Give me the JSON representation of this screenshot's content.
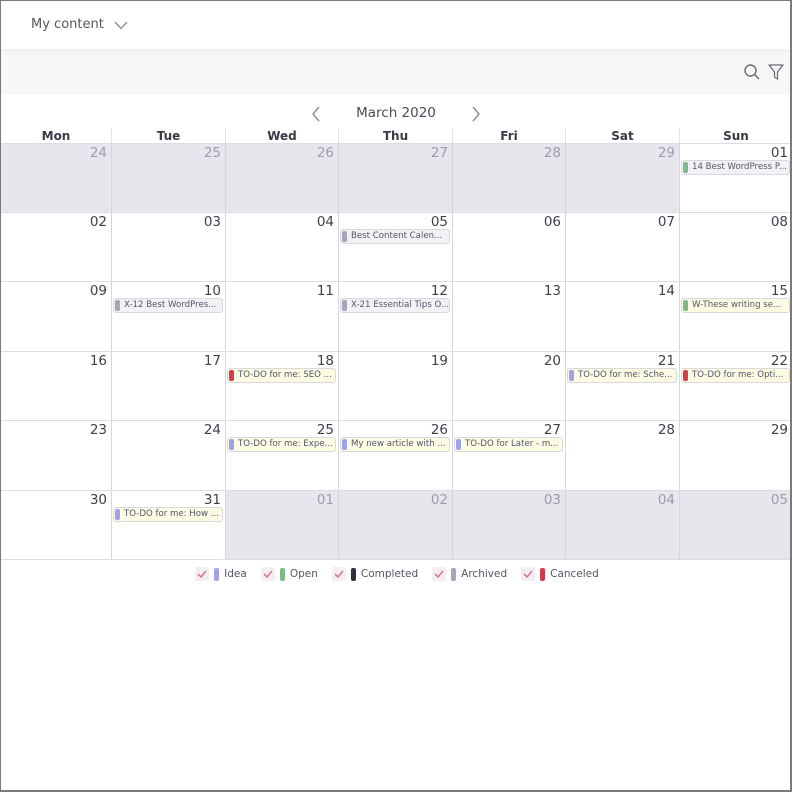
{
  "header": {
    "content_selector_label": "My content",
    "dropdown_icon": "chevron-down-icon"
  },
  "toolbar": {
    "search_icon": "search-icon",
    "filter_icon": "filter-icon"
  },
  "calendar": {
    "month_title": "March 2020",
    "prev_icon": "chevron-left-icon",
    "next_icon": "chevron-right-icon",
    "weekdays": [
      "Mon",
      "Tue",
      "Wed",
      "Thu",
      "Fri",
      "Sat",
      "Sun"
    ],
    "weeks": [
      [
        {
          "day": "24",
          "other": true
        },
        {
          "day": "25",
          "other": true
        },
        {
          "day": "26",
          "other": true
        },
        {
          "day": "27",
          "other": true
        },
        {
          "day": "28",
          "other": true
        },
        {
          "day": "29",
          "other": true
        },
        {
          "day": "01",
          "other": false,
          "event": {
            "title": "14 Best WordPress P...",
            "status": "Open",
            "highlight": false
          }
        }
      ],
      [
        {
          "day": "02",
          "other": false
        },
        {
          "day": "03",
          "other": false
        },
        {
          "day": "04",
          "other": false
        },
        {
          "day": "05",
          "other": false,
          "event": {
            "title": "Best Content Calen...",
            "status": "Archived",
            "highlight": false
          }
        },
        {
          "day": "06",
          "other": false
        },
        {
          "day": "07",
          "other": false
        },
        {
          "day": "08",
          "other": false
        }
      ],
      [
        {
          "day": "09",
          "other": false
        },
        {
          "day": "10",
          "other": false,
          "event": {
            "title": "X-12 Best WordPres...",
            "status": "Archived",
            "highlight": false
          }
        },
        {
          "day": "11",
          "other": false
        },
        {
          "day": "12",
          "other": false,
          "event": {
            "title": "X-21 Essential Tips O...",
            "status": "Archived",
            "highlight": false
          }
        },
        {
          "day": "13",
          "other": false
        },
        {
          "day": "14",
          "other": false
        },
        {
          "day": "15",
          "other": false,
          "event": {
            "title": "W-These writing se...",
            "status": "Open",
            "highlight": true
          }
        }
      ],
      [
        {
          "day": "16",
          "other": false
        },
        {
          "day": "17",
          "other": false
        },
        {
          "day": "18",
          "other": false,
          "event": {
            "title": "TO-DO for me: SEO ...",
            "status": "Canceled",
            "highlight": true
          }
        },
        {
          "day": "19",
          "other": false
        },
        {
          "day": "20",
          "other": false
        },
        {
          "day": "21",
          "other": false,
          "event": {
            "title": "TO-DO for me: Sche...",
            "status": "Idea",
            "highlight": true
          }
        },
        {
          "day": "22",
          "other": false,
          "event": {
            "title": "TO-DO for me: Opti...",
            "status": "Canceled",
            "highlight": true
          }
        }
      ],
      [
        {
          "day": "23",
          "other": false
        },
        {
          "day": "24",
          "other": false
        },
        {
          "day": "25",
          "other": false,
          "event": {
            "title": "TO-DO for me: Expe...",
            "status": "Idea",
            "highlight": true
          }
        },
        {
          "day": "26",
          "other": false,
          "event": {
            "title": "My new article with ...",
            "status": "Idea",
            "highlight": true
          }
        },
        {
          "day": "27",
          "other": false,
          "event": {
            "title": "TO-DO for Later - m...",
            "status": "Idea",
            "highlight": true
          }
        },
        {
          "day": "28",
          "other": false
        },
        {
          "day": "29",
          "other": false
        }
      ],
      [
        {
          "day": "30",
          "other": false
        },
        {
          "day": "31",
          "other": false,
          "event": {
            "title": "TO-DO for me: How ...",
            "status": "Idea",
            "highlight": true
          }
        },
        {
          "day": "01",
          "other": true
        },
        {
          "day": "02",
          "other": true
        },
        {
          "day": "03",
          "other": true
        },
        {
          "day": "04",
          "other": true
        },
        {
          "day": "05",
          "other": true
        }
      ]
    ]
  },
  "legend": [
    {
      "label": "Idea",
      "checked": true,
      "color": "#9fa3e6"
    },
    {
      "label": "Open",
      "checked": true,
      "color": "#7fb88a"
    },
    {
      "label": "Completed",
      "checked": true,
      "color": "#2e2f3d"
    },
    {
      "label": "Archived",
      "checked": true,
      "color": "#a3a5b8"
    },
    {
      "label": "Canceled",
      "checked": true,
      "color": "#d53a4f"
    }
  ],
  "status_colors": {
    "Idea": "#9fa3e6",
    "Open": "#7fb88a",
    "Completed": "#2e2f3d",
    "Archived": "#a3a5b8",
    "Canceled": "#d53a4f"
  },
  "check_color": "#d9789a"
}
